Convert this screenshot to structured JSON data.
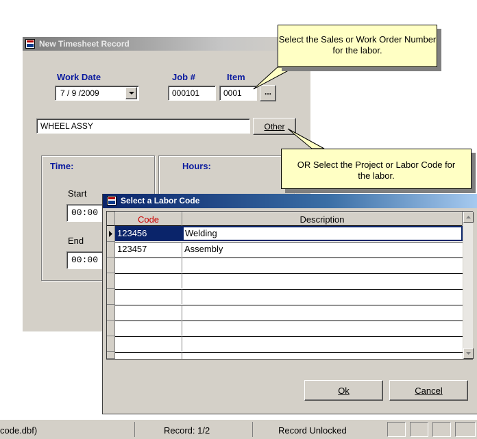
{
  "timesheet": {
    "title": "New Timesheet Record",
    "work_date_label": "Work Date",
    "work_date_value": "7 / 9 /2009",
    "job_label": "Job #",
    "job_value": "000101",
    "item_label": "Item",
    "item_value": "0001",
    "browse_label": "...",
    "description_value": "WHEEL ASSY",
    "other_button_label": "Other",
    "time_group_label": "Time:",
    "hours_group_label": "Hours:",
    "start_label": "Start",
    "start_value": "00:00",
    "end_label": "End",
    "end_value": "00:00"
  },
  "callouts": {
    "sales_order": "Select the Sales or Work Order Number for the labor.",
    "project_labor": "OR Select the Project or Labor Code for the labor."
  },
  "labor_dialog": {
    "title": "Select a Labor Code",
    "columns": [
      "Code",
      "Description"
    ],
    "rows": [
      {
        "code": "123456",
        "description": "Welding"
      },
      {
        "code": "123457",
        "description": "Assembly"
      }
    ],
    "ok_label": "Ok",
    "cancel_label": "Cancel"
  },
  "statusbar": {
    "file_text": "code.dbf)",
    "record_text": "Record: 1/2",
    "lock_text": "Record Unlocked"
  },
  "colors": {
    "header_code": "#cc0000",
    "label_blue": "#0a1a9e",
    "selected_row": "#0a246a",
    "callout_bg": "#ffffc4"
  }
}
